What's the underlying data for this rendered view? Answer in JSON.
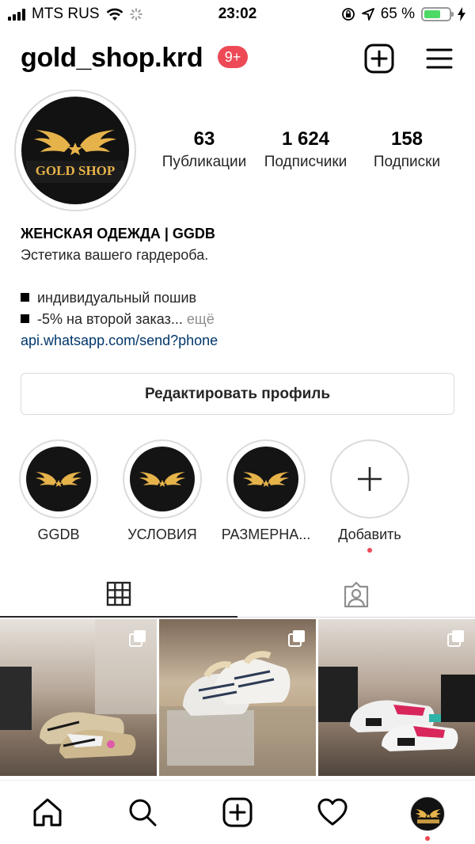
{
  "status_bar": {
    "carrier": "MTS RUS",
    "time": "23:02",
    "battery_percent": "65 %",
    "battery_level": 0.65
  },
  "header": {
    "username": "gold_shop.krd",
    "notification_badge": "9+",
    "icons": [
      "new-post-icon",
      "menu-icon"
    ]
  },
  "profile": {
    "avatar_logo_text": "GOLD SHOP",
    "stats": [
      {
        "value": "63",
        "label": "Публикации"
      },
      {
        "value": "1 624",
        "label": "Подписчики"
      },
      {
        "value": "158",
        "label": "Подписки"
      }
    ],
    "bio": {
      "name": "ЖЕНСКАЯ ОДЕЖДА | GGDB",
      "tagline": "Эстетика вашего гардероба.",
      "bullet_1": "индивидуальный пошив",
      "bullet_2": "-5% на второй заказ...",
      "more": "ещё",
      "link": "api.whatsapp.com/send?phone"
    },
    "edit_button": "Редактировать профиль"
  },
  "highlights": [
    {
      "label": "GGDB"
    },
    {
      "label": "УСЛОВИЯ"
    },
    {
      "label": "РАЗМЕРНА..."
    },
    {
      "label": "Добавить"
    }
  ],
  "tabs": {
    "active": "grid",
    "items": [
      "grid-icon",
      "tagged-icon"
    ]
  },
  "posts": [
    {
      "type": "carousel"
    },
    {
      "type": "carousel"
    },
    {
      "type": "carousel"
    }
  ],
  "bottom_nav": {
    "items": [
      "home-icon",
      "search-icon",
      "new-post-icon",
      "activity-heart-icon",
      "profile-avatar"
    ]
  },
  "colors": {
    "badge": "#ed4956",
    "link": "#00376b",
    "logo_gold": "#e6b24a",
    "battery_green": "#4cd964"
  }
}
